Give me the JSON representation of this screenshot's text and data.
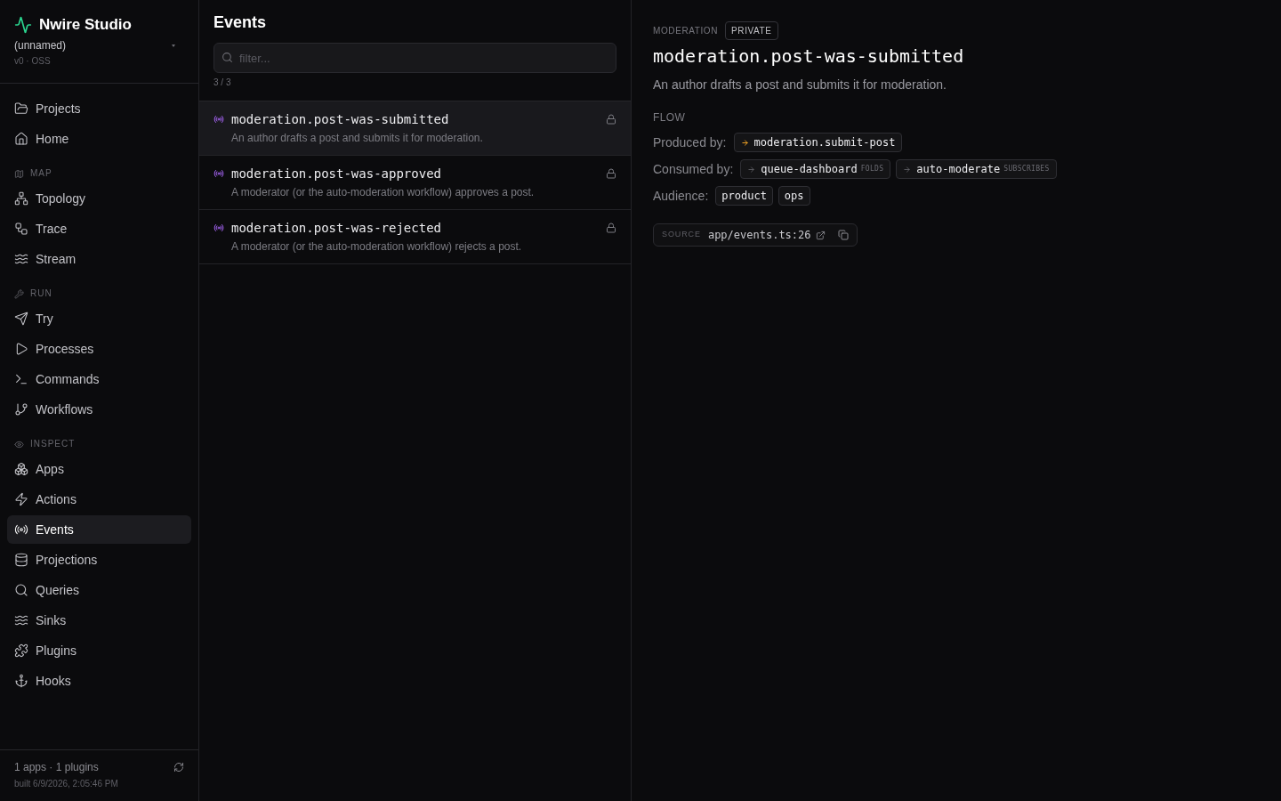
{
  "sidebar": {
    "brand": "Nwire Studio",
    "project": "(unnamed)",
    "version": "v0 · OSS",
    "sections": [
      {
        "items": [
          {
            "label": "Projects",
            "selected": false
          },
          {
            "label": "Home",
            "selected": false
          }
        ]
      },
      {
        "label": "MAP",
        "items": [
          {
            "label": "Topology",
            "selected": false
          },
          {
            "label": "Trace",
            "selected": false
          },
          {
            "label": "Stream",
            "selected": false
          }
        ]
      },
      {
        "label": "RUN",
        "items": [
          {
            "label": "Try",
            "selected": false
          },
          {
            "label": "Processes",
            "selected": false
          },
          {
            "label": "Commands",
            "selected": false
          },
          {
            "label": "Workflows",
            "selected": false
          }
        ]
      },
      {
        "label": "INSPECT",
        "items": [
          {
            "label": "Apps",
            "selected": false
          },
          {
            "label": "Actions",
            "selected": false
          },
          {
            "label": "Events",
            "selected": true
          },
          {
            "label": "Projections",
            "selected": false
          },
          {
            "label": "Queries",
            "selected": false
          },
          {
            "label": "Sinks",
            "selected": false
          },
          {
            "label": "Plugins",
            "selected": false
          },
          {
            "label": "Hooks",
            "selected": false
          }
        ]
      }
    ],
    "footer": {
      "summary": "1 apps · 1 plugins",
      "built": "built 6/9/2026, 2:05:46 PM"
    }
  },
  "events_panel": {
    "title": "Events",
    "filter": {
      "placeholder": "filter..."
    },
    "count": "3 / 3",
    "events": [
      {
        "name": "moderation.post-was-submitted",
        "description": "An author drafts a post and submits it for moderation.",
        "private": true,
        "selected": true
      },
      {
        "name": "moderation.post-was-approved",
        "description": "A moderator (or the auto-moderation workflow) approves a post.",
        "private": true,
        "selected": false
      },
      {
        "name": "moderation.post-was-rejected",
        "description": "A moderator (or the auto-moderation workflow) rejects a post.",
        "private": true,
        "selected": false
      }
    ]
  },
  "detail": {
    "module": "MODERATION",
    "visibility": "PRIVATE",
    "name": "moderation.post-was-submitted",
    "description": "An author drafts a post and submits it for moderation.",
    "flow": {
      "heading": "FLOW",
      "produced_label": "Produced by:",
      "produced_by": [
        {
          "name": "moderation.submit-post"
        }
      ],
      "consumed_label": "Consumed by:",
      "consumed_by": [
        {
          "name": "queue-dashboard",
          "mode": "FOLDS"
        },
        {
          "name": "auto-moderate",
          "mode": "SUBSCRIBES"
        }
      ],
      "audience_label": "Audience:",
      "audience": [
        "product",
        "ops"
      ]
    },
    "source": {
      "label": "SOURCE",
      "path": "app/events.ts:26"
    }
  }
}
